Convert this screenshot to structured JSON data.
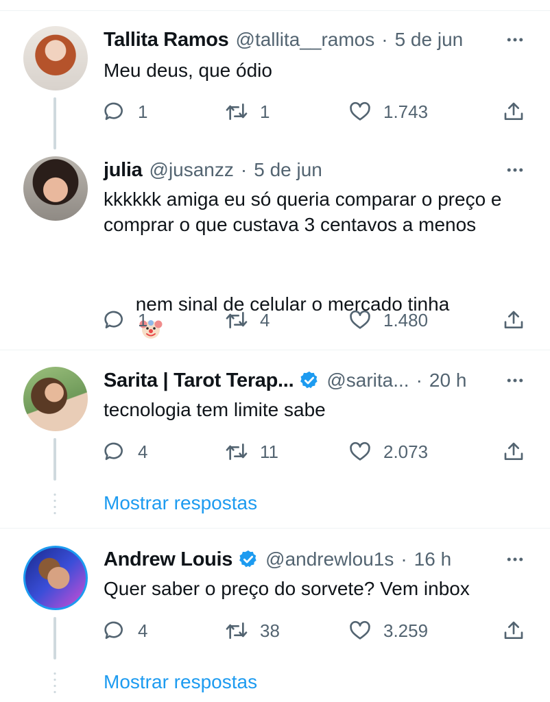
{
  "tweets": [
    {
      "name": "Tallita Ramos",
      "handle": "@tallita__ramos",
      "separator": "·",
      "time": "5 de jun",
      "text": "Meu deus, que ódio",
      "replies": "1",
      "retweets": "1",
      "likes": "1.743",
      "verified": false
    },
    {
      "name": "julia",
      "handle": "@jusanzz",
      "separator": "·",
      "time": "5 de jun",
      "text_line1": "kkkkkk amiga eu só queria comparar o preço e",
      "text_line2": "comprar o que custava 3 centavos a menos",
      "text_line3": "nem sinal de celular o mercado tinha",
      "emoji": "clown-face",
      "replies": "1",
      "retweets": "4",
      "likes": "1.480",
      "verified": false
    },
    {
      "name": "Sarita | Tarot Terap...",
      "handle": "@sarita...",
      "separator": "·",
      "time": "20 h",
      "text": "tecnologia tem limite sabe",
      "replies": "4",
      "retweets": "11",
      "likes": "2.073",
      "verified": true,
      "show_replies": "Mostrar respostas"
    },
    {
      "name": "Andrew Louis",
      "handle": "@andrewlou1s",
      "separator": "·",
      "time": "16 h",
      "text": "Quer saber o preço do sorvete? Vem inbox",
      "replies": "4",
      "retweets": "38",
      "likes": "3.259",
      "verified": true,
      "show_replies": "Mostrar respostas"
    }
  ],
  "colors": {
    "link": "#1d9bf0",
    "secondary_text": "#536471",
    "verified": "#1d9bf0",
    "thread_line": "#cfd9de"
  }
}
